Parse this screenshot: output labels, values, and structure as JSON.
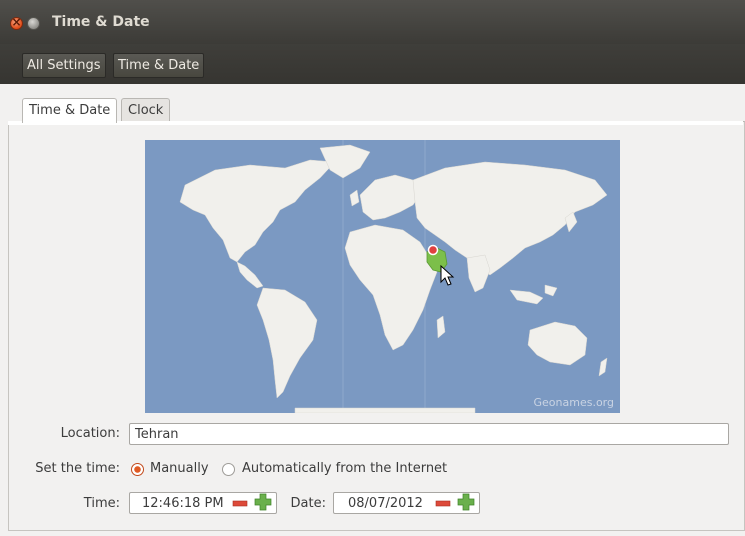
{
  "window": {
    "title": "Time & Date"
  },
  "toolbar": {
    "all_settings": "All Settings",
    "current": "Time & Date"
  },
  "tabs": [
    {
      "label": "Time & Date",
      "active": true
    },
    {
      "label": "Clock",
      "active": false
    }
  ],
  "map": {
    "credit": "Geonames.org",
    "selected_region": "Iran"
  },
  "location": {
    "label": "Location:",
    "value": "Tehran"
  },
  "set_time": {
    "label": "Set the time:",
    "options": [
      {
        "label": "Manually",
        "selected": true
      },
      {
        "label": "Automatically from the Internet",
        "selected": false
      }
    ]
  },
  "time": {
    "label": "Time:",
    "value": "12:46:18 PM"
  },
  "date": {
    "label": "Date:",
    "value": "08/07/2012"
  },
  "colors": {
    "titlebar": "#3c3b37",
    "map_water": "#7b99c2",
    "map_land": "#f1f0ec",
    "accent": "#e05a23",
    "plus": "#6ab04c",
    "minus": "#dd4a3a"
  }
}
